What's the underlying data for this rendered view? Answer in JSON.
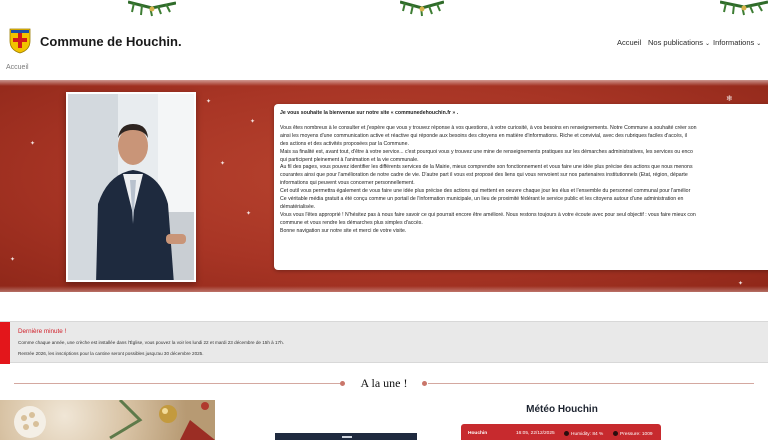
{
  "header": {
    "site_title": "Commune de Houchin.",
    "nav": [
      {
        "label": "Accueil",
        "chevron": ""
      },
      {
        "label": "Nos publications",
        "chevron": "⌄"
      },
      {
        "label": "Informations",
        "chevron": "⌄"
      }
    ]
  },
  "breadcrumb": "Accueil",
  "welcome": {
    "intro": "Je vous souhaite la bienvenue sur notre site « communedehouchin.fr » .",
    "lines": [
      "Vous êtes nombreux à le consulter et j'espère que vous y trouvez réponse à vos questions, à votre curiosité, à vos besoins en renseignements. Notre Commune a souhaité créer son",
      "ainsi les moyens d'une communication active et réactive qui réponde aux besoins des citoyens en matière d'informations. Riche et convivial, avec des rubriques faciles d'accès, il",
      "des actions et des activités proposées par la Commune.",
      "Mais sa finalité est, avant tout, d'être à votre service... c'est pourquoi vous y trouvez une mine de renseignements pratiques sur les démarches administratives, les services ou enco",
      "qui participent pleinement à l'animation et la vie communale.",
      "Au fil des pages, vous pouvez identifier les différents services de la Mairie, mieux comprendre son fonctionnement et vous faire une idée plus précise des actions que nous menons",
      "courantes ainsi que pour l'amélioration de notre cadre de vie. D'autre part il vous est proposé des liens qui vous renvoient sur nos partenaires institutionnels (Etat, région, départe",
      "informations qui peuvent vous concerner personnellement.",
      "Cet outil vous permettra également de vous faire une idée plus précise des actions qui mettent en oeuvre chaque jour les élus et l'ensemble du personnel communal pour l'amélior",
      "Ce véritable média gratuit a été conçu comme un portail de l'information municipale, un lieu de proximité fédérant le service public et les citoyens autour d'une administration en",
      "dématérialisée.",
      "Vous vous l'êtes approprié ! N'hésitez pas à nous faire savoir ce qui pourrait encore être amélioré. Nous restons toujours à votre écoute avec pour seul objectif : vous faire mieux con",
      "commune et vous rendre les démarches plus simples d'accès.",
      "Bonne navigation sur notre site et merci de votre visite."
    ]
  },
  "news": {
    "title": "Dernière minute !",
    "line1": "Comme chaque année, une crèche est installée dans l'Église, vous pouvez la voir les lundi 22 et mardi 23 décembre de 15h à 17h.",
    "line2": "Rentrée 2026, les inscriptions pour la cantine seront possibles jusqu'au 30 décembre 2025."
  },
  "une_title": "A la une !",
  "meteo": {
    "title": "Météo Houchin",
    "city": "Houchin",
    "datetime": "16:05, 22/12/2025",
    "humidity": "Humidity: 84 %",
    "pressure": "Pressure: 1009"
  },
  "colors": {
    "hero_red": "#a83525",
    "news_accent": "#e3161b",
    "meteo_card": "#c72a2e"
  },
  "icons": [
    "shield-logo-icon",
    "chevron-down-icon",
    "humidity-icon",
    "pressure-icon"
  ]
}
